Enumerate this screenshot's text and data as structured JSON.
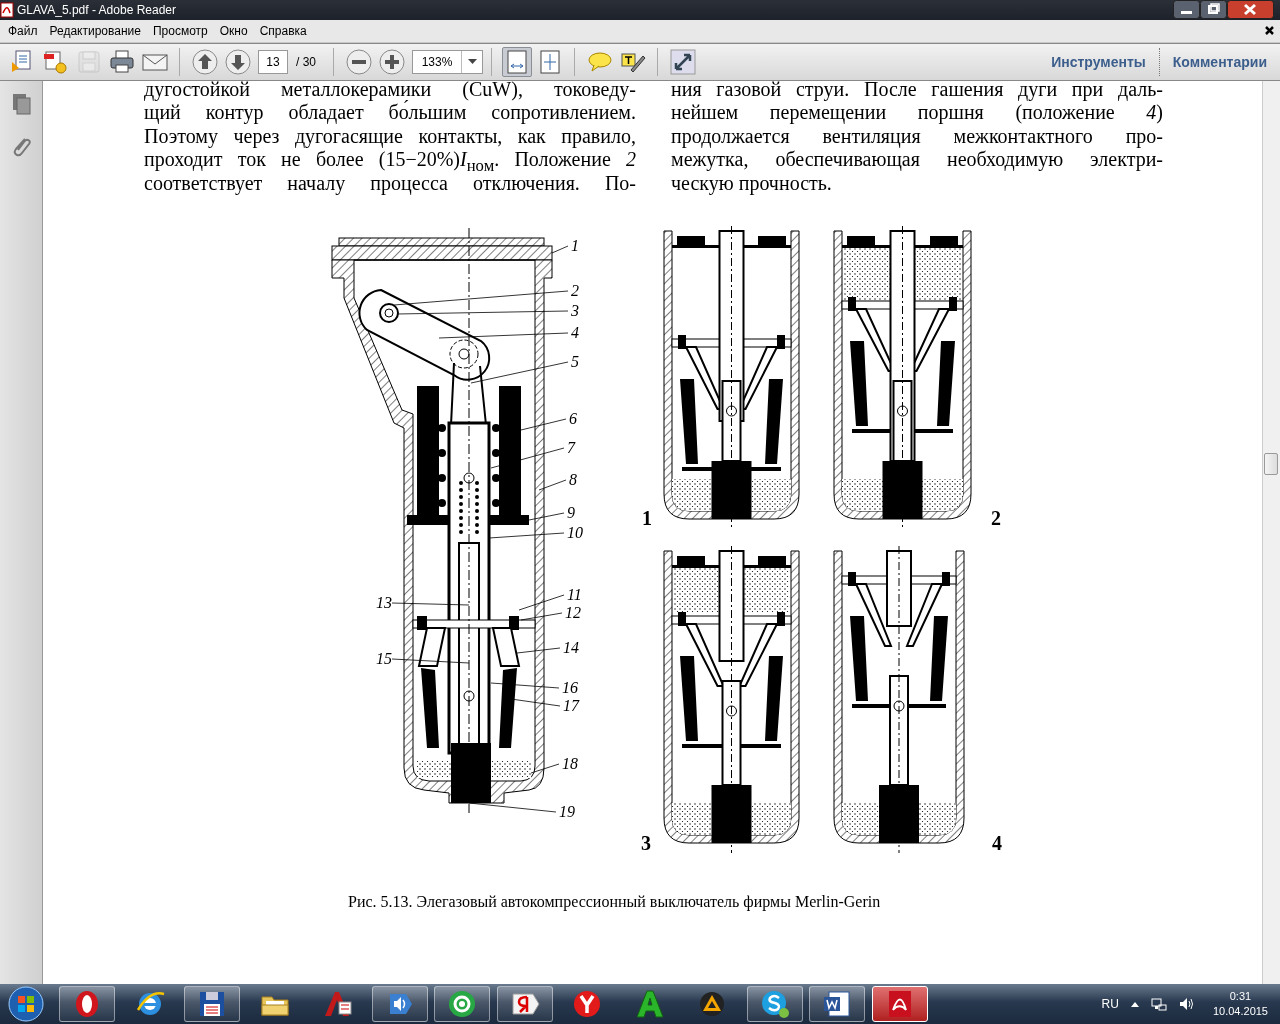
{
  "window": {
    "title": "GLAVA_5.pdf - Adobe Reader"
  },
  "menu": [
    "Файл",
    "Редактирование",
    "Просмотр",
    "Окно",
    "Справка"
  ],
  "toolbar": {
    "file_buttons": [
      {
        "kind": "create",
        "disabled": false
      },
      {
        "kind": "combine",
        "disabled": false
      },
      {
        "kind": "save",
        "disabled": true
      },
      {
        "kind": "print",
        "disabled": false
      },
      {
        "kind": "email",
        "disabled": false
      }
    ],
    "nav_buttons": [
      {
        "kind": "prev",
        "disabled": false
      },
      {
        "kind": "next",
        "disabled": false
      }
    ],
    "page": {
      "value": "13",
      "total": "/ 30"
    },
    "zoom_buttons": [
      {
        "kind": "zoom-out",
        "disabled": false
      },
      {
        "kind": "zoom-in",
        "disabled": false
      }
    ],
    "zoom": {
      "value": "133%"
    },
    "view_buttons": [
      {
        "kind": "fit-width",
        "selected": true
      },
      {
        "kind": "fit-page",
        "selected": false
      }
    ],
    "annotate_buttons": [
      {
        "kind": "comment",
        "disabled": false
      },
      {
        "kind": "highlight",
        "disabled": false
      }
    ],
    "extra_buttons": [
      {
        "kind": "fullscreen",
        "disabled": false
      }
    ],
    "panels": [
      "Инструменты",
      "Комментарии"
    ]
  },
  "document": {
    "left_column": [
      "дугостойкой металлокерамики (CuW), токоведу-",
      "щий контур обладает бо́льшим сопротивлением.",
      "Поэтому через дугогасящие контакты, как правило,",
      "проходит ток не более (15−20%)*I*$_{ном}$. Положение *2*",
      "соответствует началу процесса отключения. По-"
    ],
    "right_column": [
      "ния газовой струи. После гашения дуги при даль-",
      "нейшем перемещении поршня (положение *4*)",
      "продолжается вентиляция межконтактного про-",
      "межутка, обеспечивающая необходимую электри-",
      "ческую прочность."
    ],
    "figure": {
      "callouts": [
        "13",
        "15",
        "1",
        "2",
        "3",
        "4",
        "5",
        "6",
        "7",
        "8",
        "9",
        "10",
        "11",
        "12",
        "14",
        "16",
        "17",
        "18",
        "19"
      ],
      "positions": [
        "1",
        "2",
        "3",
        "4"
      ]
    },
    "caption": "Рис. 5.13. Элегазовый автокомпрессионный выключатель фирмы Merlin-Gerin"
  },
  "taskbar": {
    "apps": [
      {
        "kind": "opera",
        "running": true,
        "selected": false
      },
      {
        "kind": "ie",
        "running": false,
        "selected": false
      },
      {
        "kind": "floppy",
        "running": true,
        "selected": false
      },
      {
        "kind": "folder",
        "running": false,
        "selected": false
      },
      {
        "kind": "cad",
        "running": false,
        "selected": false
      },
      {
        "kind": "speaker",
        "running": true,
        "selected": false
      },
      {
        "kind": "mail",
        "running": true,
        "selected": false
      },
      {
        "kind": "yandex",
        "running": true,
        "selected": false
      },
      {
        "kind": "ybrowser",
        "running": false,
        "selected": false
      },
      {
        "kind": "a-letter",
        "running": false,
        "selected": false
      },
      {
        "kind": "cone",
        "running": false,
        "selected": false
      },
      {
        "kind": "skype",
        "running": true,
        "selected": false
      },
      {
        "kind": "word",
        "running": true,
        "selected": false
      },
      {
        "kind": "acrobat",
        "running": true,
        "selected": true
      }
    ],
    "tray": {
      "language": "RU",
      "time": "0:31",
      "date": "10.04.2015"
    }
  }
}
